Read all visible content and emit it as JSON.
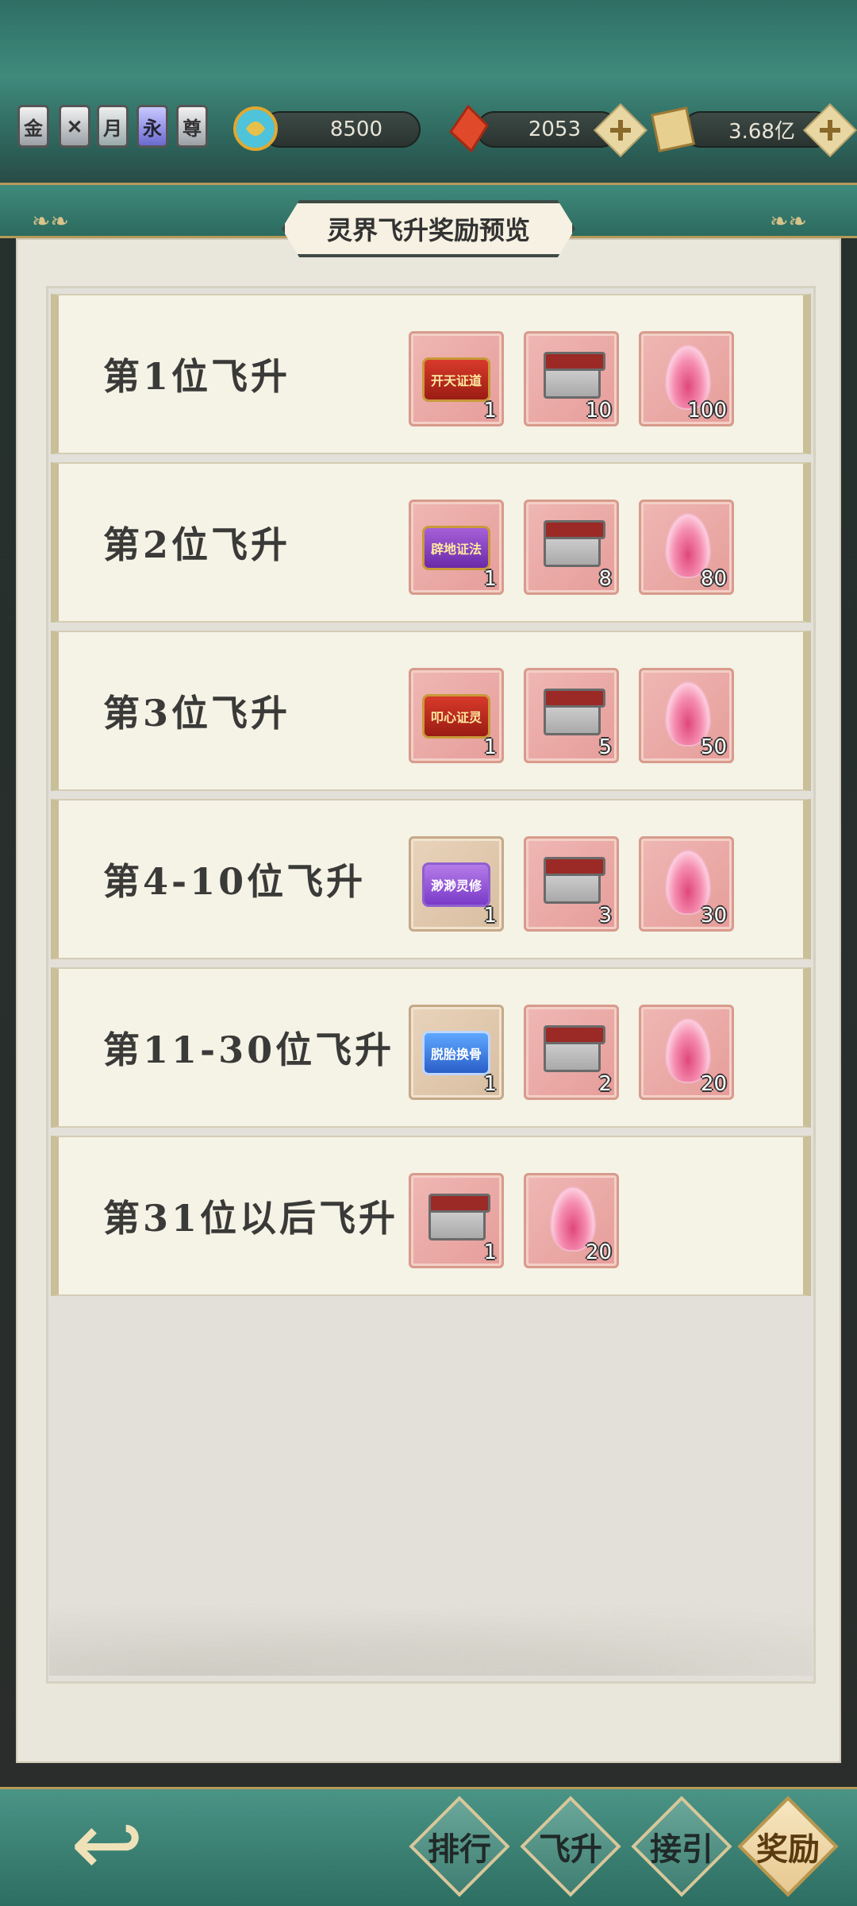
{
  "top_bar": {
    "badges": [
      "金",
      "",
      "月",
      "永",
      "尊"
    ],
    "currency_1": "8500",
    "currency_2": "2053",
    "currency_3": "3.68亿"
  },
  "header": {
    "title": "灵界飞升奖励预览"
  },
  "rewards": [
    {
      "label": "第1位飞升",
      "items": [
        {
          "kind": "scroll",
          "variant": "red",
          "text": "开天证道",
          "qty": "1"
        },
        {
          "kind": "chest",
          "qty": "10"
        },
        {
          "kind": "gem",
          "qty": "100"
        }
      ]
    },
    {
      "label": "第2位飞升",
      "items": [
        {
          "kind": "scroll",
          "variant": "purple",
          "text": "辟地证法",
          "qty": "1"
        },
        {
          "kind": "chest",
          "qty": "8"
        },
        {
          "kind": "gem",
          "qty": "80"
        }
      ]
    },
    {
      "label": "第3位飞升",
      "items": [
        {
          "kind": "scroll",
          "variant": "red",
          "text": "叩心证灵",
          "qty": "1"
        },
        {
          "kind": "chest",
          "qty": "5"
        },
        {
          "kind": "gem",
          "qty": "50"
        }
      ]
    },
    {
      "label": "第4-10位飞升",
      "items": [
        {
          "kind": "scroll",
          "variant": "violet",
          "text": "渺渺灵修",
          "qty": "1",
          "tan": true
        },
        {
          "kind": "chest",
          "qty": "3"
        },
        {
          "kind": "gem",
          "qty": "30"
        }
      ]
    },
    {
      "label": "第11-30位飞升",
      "items": [
        {
          "kind": "scroll",
          "variant": "blue",
          "text": "脱胎换骨",
          "qty": "1",
          "tan": true
        },
        {
          "kind": "chest",
          "qty": "2"
        },
        {
          "kind": "gem",
          "qty": "20"
        }
      ]
    },
    {
      "label": "第31位以后飞升",
      "items": [
        {
          "kind": "chest",
          "qty": "1"
        },
        {
          "kind": "gem",
          "qty": "20"
        }
      ]
    }
  ],
  "bottom_nav": {
    "back_glyph": "↩",
    "tabs": [
      "排行",
      "飞升",
      "接引",
      "奖励"
    ],
    "active": "奖励"
  }
}
